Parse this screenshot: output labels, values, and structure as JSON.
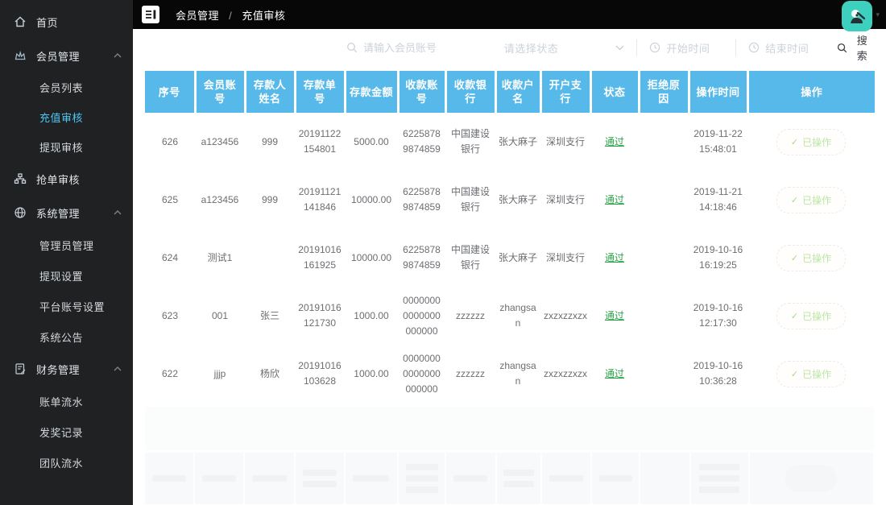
{
  "colors": {
    "header_blue": "#57b9ea",
    "active_cyan": "#4fc7f3",
    "status_green": "#2aa348",
    "avatar_teal": "#3ed0bf",
    "sidebar_bg": "#1f2123",
    "topbar_bg": "#070708"
  },
  "topbar": {
    "breadcrumb_section": "会员管理",
    "breadcrumb_separator": "/",
    "breadcrumb_page": "充值审核"
  },
  "sidebar": {
    "home": "首页",
    "member_group": "会员管理",
    "member_children": [
      "会员列表",
      "充值审核",
      "提现审核"
    ],
    "active_item": "充值审核",
    "order_review": "抢单审核",
    "system_group": "系统管理",
    "system_children": [
      "管理员管理",
      "提现设置",
      "平台账号设置",
      "系统公告"
    ],
    "finance_group": "财务管理",
    "finance_children": [
      "账单流水",
      "发奖记录",
      "团队流水"
    ]
  },
  "filters": {
    "account_placeholder": "请输入会员账号",
    "status_placeholder": "请选择状态",
    "start_placeholder": "开始时间",
    "end_placeholder": "结束时间",
    "search_label": "搜索"
  },
  "table": {
    "headers": [
      "序号",
      "会员账号",
      "存款人姓名",
      "存款单号",
      "存款金额",
      "收款账号",
      "收款银行",
      "收款户名",
      "开户支行",
      "状态",
      "拒绝原因",
      "操作时间",
      "操作"
    ],
    "action_check": "✓",
    "rows": [
      {
        "seq": "626",
        "account": "a123456",
        "depositor": "999",
        "order_no": "20191122154801",
        "amount": "5000.00",
        "recv_account": "62258789874859",
        "recv_bank": "中国建设银行",
        "recv_name": "张大麻子",
        "branch": "深圳支行",
        "status": "通过",
        "reject_reason": "",
        "op_time": "2019-11-22 15:48:01",
        "action": "已操作"
      },
      {
        "seq": "625",
        "account": "a123456",
        "depositor": "999",
        "order_no": "20191121141846",
        "amount": "10000.00",
        "recv_account": "62258789874859",
        "recv_bank": "中国建设银行",
        "recv_name": "张大麻子",
        "branch": "深圳支行",
        "status": "通过",
        "reject_reason": "",
        "op_time": "2019-11-21 14:18:46",
        "action": "已操作"
      },
      {
        "seq": "624",
        "account": "测试1",
        "depositor": "",
        "order_no": "20191016161925",
        "amount": "10000.00",
        "recv_account": "62258789874859",
        "recv_bank": "中国建设银行",
        "recv_name": "张大麻子",
        "branch": "深圳支行",
        "status": "通过",
        "reject_reason": "",
        "op_time": "2019-10-16 16:19:25",
        "action": "已操作"
      },
      {
        "seq": "623",
        "account": "001",
        "depositor": "张三",
        "order_no": "20191016121730",
        "amount": "1000.00",
        "recv_account": "00000000000000000000",
        "recv_bank": "zzzzzz",
        "recv_name": "zhangsan",
        "branch": "zxzxzzxzx",
        "status": "通过",
        "reject_reason": "",
        "op_time": "2019-10-16 12:17:30",
        "action": "已操作"
      },
      {
        "seq": "622",
        "account": "jjjp",
        "depositor": "杨欣",
        "order_no": "20191016103628",
        "amount": "1000.00",
        "recv_account": "00000000000000000000",
        "recv_bank": "zzzzzz",
        "recv_name": "zhangsan",
        "branch": "zxzxzzxzx",
        "status": "通过",
        "reject_reason": "",
        "op_time": "2019-10-16 10:36:28",
        "action": "已操作"
      }
    ]
  }
}
